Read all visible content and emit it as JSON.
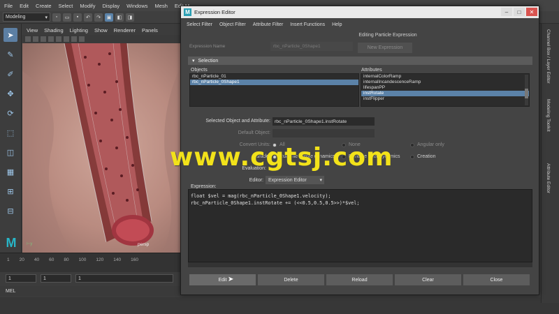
{
  "maya": {
    "menubar": [
      "File",
      "Edit",
      "Create",
      "Select",
      "Modify",
      "Display",
      "Windows",
      "Mesh",
      "Edit M"
    ],
    "mode": "Modeling",
    "view_menu": [
      "View",
      "Shading",
      "Lighting",
      "Show",
      "Renderer",
      "Panels"
    ],
    "viewport_label": "persp",
    "timeline_ticks": [
      "1",
      "20",
      "40",
      "60",
      "80",
      "100",
      "120",
      "140",
      "160"
    ],
    "range_start": "1",
    "range_current": "1",
    "range_end": "1",
    "mel_label": "MEL",
    "right_tabs": [
      "Channel Box / Layer Editor",
      "Modeling Toolkit",
      "Attribute Editor"
    ]
  },
  "dialog": {
    "title": "Expression Editor",
    "menu": [
      "Select Filter",
      "Object Filter",
      "Attribute Filter",
      "Insert Functions",
      "Help"
    ],
    "editing_title": "Editing Particle Expression",
    "expression_name_label": "Expression Name",
    "expression_name_value": "rbc_nParticle_0Shape1",
    "new_expression_label": "New Expression",
    "section_label": "Selection",
    "objects_label": "Objects",
    "objects": [
      {
        "name": "rbc_nParticle_01",
        "selected": false
      },
      {
        "name": "rbc_nParticle_0Shape1",
        "selected": true
      }
    ],
    "attributes_label": "Attributes",
    "attributes": [
      {
        "name": "internalColorRamp",
        "selected": false
      },
      {
        "name": "internalIncandescenceRamp",
        "selected": false
      },
      {
        "name": "lifespanPP",
        "selected": false
      },
      {
        "name": "instRotate",
        "selected": true
      },
      {
        "name": "instFlipper",
        "selected": false
      }
    ],
    "selected_object_label": "Selected Object and Attribute:",
    "selected_object_value": "rbc_nParticle_0Shape1.instRotate",
    "default_object_label": "Default Object:",
    "convert_units_label": "Convert Units:",
    "convert_units_options": [
      "All",
      "None",
      "Angular only"
    ],
    "particle_label": "Particle:",
    "particle_options": [
      "Runtime before dynamics",
      "Runtime after dynamics",
      "Creation"
    ],
    "evaluation_label": "Evaluation:",
    "editor_label": "Editor:",
    "editor_value": "Expression Editor",
    "expression_label": "Expression:",
    "expression_lines": [
      "float $vel = mag(rbc_nParticle_0Shape1.velocity);",
      "rbc_nParticle_0Shape1.instRotate += (<<0.5,0.5,0.5>>)*$vel;"
    ],
    "buttons": [
      "Edit",
      "Delete",
      "Reload",
      "Clear",
      "Close"
    ]
  },
  "watermark": "www.cgtsj.com",
  "colors": {
    "selection_blue": "#5b82a8",
    "watermark_yellow": "#f2e21a",
    "maya_teal": "#28b6c8"
  }
}
